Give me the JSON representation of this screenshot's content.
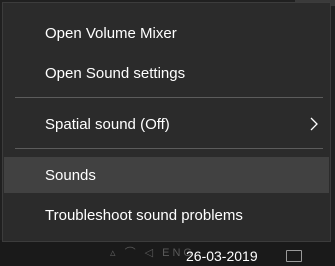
{
  "menu": {
    "items": [
      {
        "label": "Open Volume Mixer"
      },
      {
        "label": "Open Sound settings"
      },
      {
        "label": "Spatial sound (Off)",
        "submenu_icon": "chevron-right-icon"
      },
      {
        "label": "Sounds",
        "highlighted": true
      },
      {
        "label": "Troubleshoot sound problems"
      }
    ]
  },
  "taskbar": {
    "date": "26-03-2019",
    "tray_icons": [
      "wifi-icon",
      "volume-icon",
      "language-indicator",
      "notification-icon"
    ]
  },
  "colors": {
    "menu_bg": "#2b2b2b",
    "highlight_bg": "#414141",
    "separator": "#5c5c5c",
    "text": "#ffffff"
  }
}
